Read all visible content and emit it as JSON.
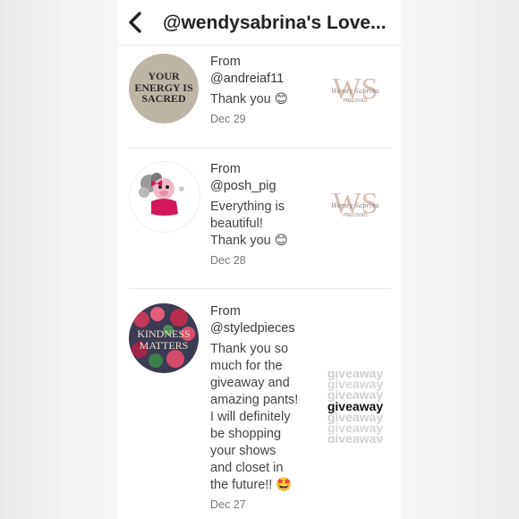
{
  "header": {
    "title": "@wendysabrina's Love..."
  },
  "items": [
    {
      "from_label": "From",
      "handle": "@andreiaf11",
      "message": "Thank you 😊",
      "date": "Dec 29",
      "avatar_text": [
        "YOUR",
        "ENERGY IS",
        "SACRED"
      ],
      "thumb_logo": "WS",
      "thumb_sub": "Wendy Sabrina",
      "thumb_tag": "PRELOVED"
    },
    {
      "from_label": "From",
      "handle": "@posh_pig",
      "message_lines": [
        "Everything is",
        "beautiful!",
        "Thank you 😊"
      ],
      "date": "Dec 28",
      "thumb_logo": "WS",
      "thumb_sub": "Wendy Sabrina",
      "thumb_tag": "PRELOVED"
    },
    {
      "from_label": "From",
      "handle": "@styledpieces",
      "message_lines": [
        "Thank you so",
        "much for the",
        "giveaway and",
        "amazing pants!",
        "I will definitely",
        "be shopping",
        "your shows",
        "and closet in",
        "the future!! 🤩"
      ],
      "date": "Dec 27",
      "avatar_text": [
        "KINDNESS",
        "MATTERS"
      ],
      "thumb_word": "giveaway"
    }
  ],
  "colors": {
    "text": "#3a3a3a",
    "date": "#777777",
    "separator": "#e9e9e9"
  }
}
